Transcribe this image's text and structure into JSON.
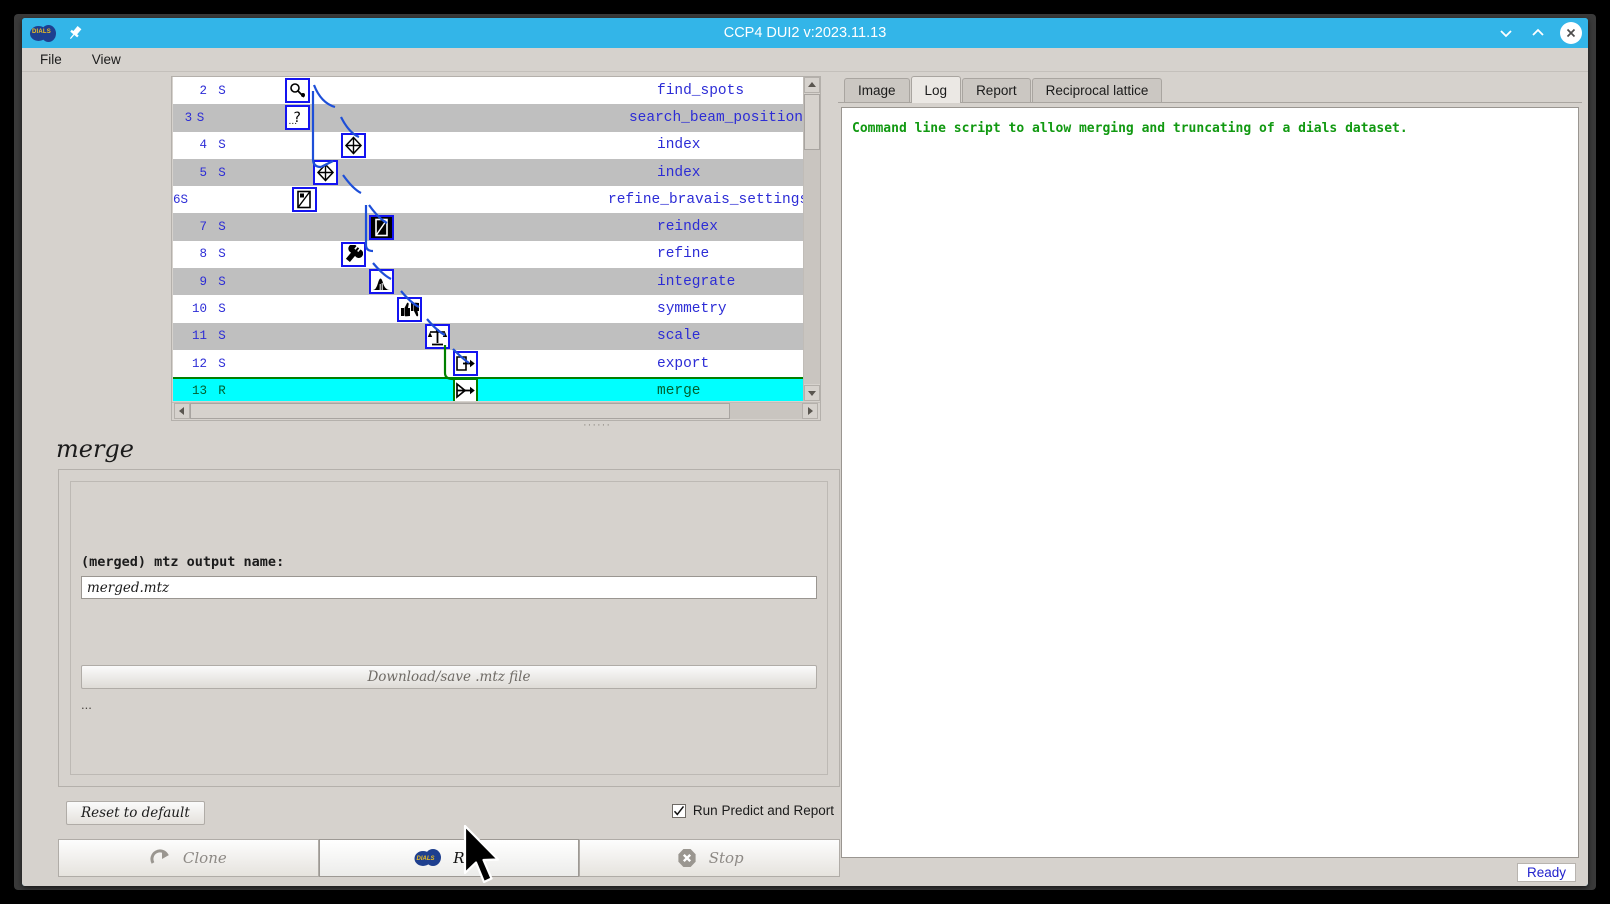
{
  "window": {
    "title": "CCP4 DUI2 v:2023.11.13",
    "logo_text": "DIALS",
    "logo_icon": "dials-logo-icon",
    "pin_icon": "pin-icon",
    "minimize_icon": "chevron-down-icon",
    "maximize_icon": "chevron-up-icon",
    "close_icon": "close-icon",
    "titlebar_color": "#33b5e8"
  },
  "menubar": {
    "items": [
      {
        "label": "File"
      },
      {
        "label": "View"
      }
    ]
  },
  "tree": {
    "columns": [
      "number",
      "status",
      "icon",
      "label"
    ],
    "rows": [
      {
        "number": "2",
        "status": "S",
        "label": "find_spots",
        "icon": "magnifier-spot-icon",
        "selected": false,
        "indent": 0
      },
      {
        "number": "3",
        "status": "S",
        "label": "search_beam_position",
        "icon": "question-mark-icon",
        "selected": false,
        "indent": 1
      },
      {
        "number": "4",
        "status": "S",
        "label": "index",
        "icon": "crosshair-diamond-icon",
        "selected": false,
        "indent": 2
      },
      {
        "number": "5",
        "status": "S",
        "label": "index",
        "icon": "crosshair-diamond-icon",
        "selected": false,
        "indent": 1
      },
      {
        "number": "6",
        "status": "S",
        "label": "refine_bravais_settings",
        "icon": "lattice-cell-icon",
        "selected": false,
        "indent": 2
      },
      {
        "number": "7",
        "status": "S",
        "label": "reindex",
        "icon": "reindex-icon",
        "selected": false,
        "indent": 3
      },
      {
        "number": "8",
        "status": "S",
        "label": "refine",
        "icon": "wrench-icon",
        "selected": false,
        "indent": 2
      },
      {
        "number": "9",
        "status": "S",
        "label": "integrate",
        "icon": "peak-profile-icon",
        "selected": false,
        "indent": 3
      },
      {
        "number": "10",
        "status": "S",
        "label": "symmetry",
        "icon": "thumbs-icon",
        "selected": false,
        "indent": 4
      },
      {
        "number": "11",
        "status": "S",
        "label": "scale",
        "icon": "balance-scale-icon",
        "selected": false,
        "indent": 5
      },
      {
        "number": "12",
        "status": "S",
        "label": "export",
        "icon": "export-arrow-icon",
        "selected": false,
        "indent": 6
      },
      {
        "number": "13",
        "status": "R",
        "label": "merge",
        "icon": "merge-arrow-icon",
        "selected": true,
        "indent": 6
      }
    ],
    "selected_color": "#00ffff",
    "selected_border": "#008000",
    "text_color": "#2c2cd6",
    "vscroll_up_icon": "scroll-up-icon",
    "vscroll_down_icon": "scroll-down-icon",
    "hscroll_left_icon": "scroll-left-icon",
    "hscroll_right_icon": "scroll-right-icon",
    "splitter_grip": "······"
  },
  "panel": {
    "title": "merge",
    "field_label": "(merged) mtz output name:",
    "field_value": "merged.mtz",
    "field_placeholder": "merged.mtz",
    "download_button": "Download/save .mtz file",
    "more_options": "..."
  },
  "controls": {
    "reset_label": "Reset to default",
    "checkbox_label": "Run Predict and Report",
    "checkbox_checked": true,
    "clone_label": "Clone",
    "clone_icon": "clone-arrow-icon",
    "run_label": "Run",
    "run_icon": "dials-logo-icon",
    "stop_label": "Stop",
    "stop_icon": "stop-octagon-icon"
  },
  "right": {
    "tabs": [
      {
        "label": "Image",
        "active": false
      },
      {
        "label": "Log",
        "active": true
      },
      {
        "label": "Report",
        "active": false
      },
      {
        "label": "Reciprocal lattice",
        "active": false
      }
    ],
    "log_lines": [
      "Command line script to allow merging and truncating of a dials dataset."
    ],
    "log_color": "#119911"
  },
  "statusbar": {
    "status": "Ready",
    "status_color": "#2222cc"
  }
}
